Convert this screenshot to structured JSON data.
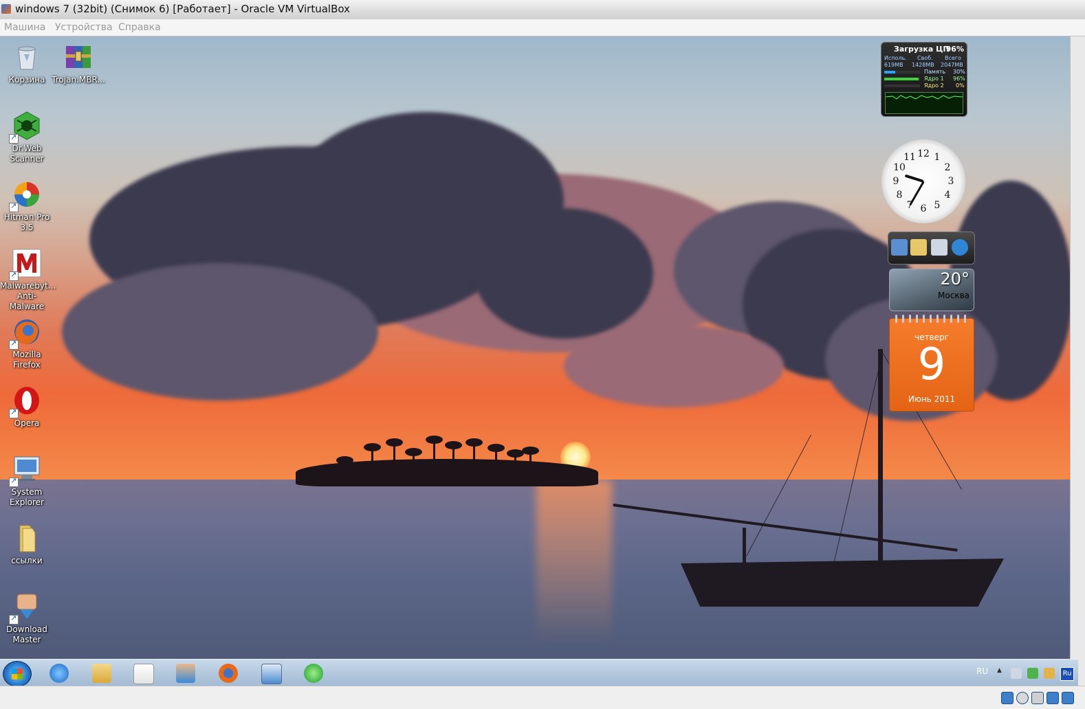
{
  "host": {
    "title": "windows 7 (32bit) (Снимок 6) [Работает] - Oracle VM VirtualBox",
    "menu": [
      "Машина",
      "Устройства",
      "Справка"
    ]
  },
  "desktop_icons": [
    {
      "label": "Корзина",
      "icon": "recycle-bin-icon"
    },
    {
      "label": "Trojan.MBR...",
      "icon": "winrar-archive-icon"
    },
    {
      "label": "Dr.Web Scanner",
      "icon": "drweb-spider-icon"
    },
    {
      "label": "Hitman Pro 3.5",
      "icon": "hitmanpro-shield-icon"
    },
    {
      "label": "Malwarebyt... Anti-Malware",
      "icon": "malwarebytes-icon"
    },
    {
      "label": "Mozilla Firefox",
      "icon": "firefox-icon"
    },
    {
      "label": "Opera",
      "icon": "opera-icon"
    },
    {
      "label": "System Explorer",
      "icon": "system-explorer-icon"
    },
    {
      "label": "ссылки",
      "icon": "folder-icon"
    },
    {
      "label": "Download Master",
      "icon": "download-master-icon"
    }
  ],
  "gadgets": {
    "cpu": {
      "title": "Загрузка ЦП",
      "percent": "96%",
      "mem_headers": [
        "Исполь.",
        "Своб.",
        "Всего"
      ],
      "mem_values": [
        "619МВ",
        "1428МВ",
        "2047МВ"
      ],
      "rows": [
        {
          "label": "Память",
          "value": "30%",
          "fill": 0.3
        },
        {
          "label": "Ядро 1",
          "value": "96%",
          "fill": 0.96
        },
        {
          "label": "Ядро 2",
          "value": "0%",
          "fill": 0.0
        }
      ]
    },
    "clock": {
      "numerals": [
        "12",
        "1",
        "2",
        "3",
        "4",
        "5",
        "6",
        "7",
        "8",
        "9",
        "10",
        "11"
      ],
      "time_hour": 9,
      "time_minute": 35
    },
    "slideshow": {
      "tiles": [
        "computer-icon",
        "folder-icon",
        "recycle-bin-icon",
        "internet-explorer-icon"
      ]
    },
    "weather": {
      "temperature": "20°",
      "city": "Москва"
    },
    "calendar": {
      "weekday": "четверг",
      "day": "9",
      "month_year": "Июнь 2011"
    }
  },
  "taskbar": {
    "start": "windows-start-orb",
    "pinned": [
      "internet-explorer-icon",
      "windows-explorer-icon",
      "media-player-icon",
      "network-download-icon",
      "firefox-icon",
      "control-panel-icon",
      "green-power-icon"
    ],
    "tray": {
      "language": "RU",
      "ru_badge": "Ru"
    }
  }
}
